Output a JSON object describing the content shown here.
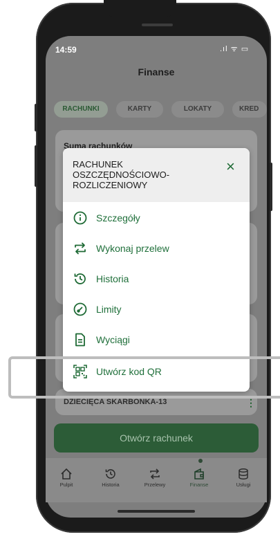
{
  "status": {
    "time": "14:59",
    "icons": ".ıl ᯤ ▭"
  },
  "header": {
    "title": "Finanse"
  },
  "tabs": [
    {
      "label": "RACHUNKI",
      "active": true
    },
    {
      "label": "KARTY",
      "active": false
    },
    {
      "label": "LOKATY",
      "active": false
    },
    {
      "label": "KRED",
      "active": false
    }
  ],
  "main": {
    "summary_label": "Suma rachunków",
    "account_name": "DZIECIĘCA SKARBONKA-13",
    "more_icon": "⋮",
    "open_account_label": "Otwórz rachunek"
  },
  "modal": {
    "title": "RACHUNEK OSZCZĘDNOŚCIOWO-ROZLICZENIOWY",
    "close_icon": "×",
    "items": [
      {
        "label": "Szczegóły",
        "icon": "info-icon"
      },
      {
        "label": "Wykonaj przelew",
        "icon": "transfer-icon"
      },
      {
        "label": "Historia",
        "icon": "history-icon"
      },
      {
        "label": "Limity",
        "icon": "gauge-icon"
      },
      {
        "label": "Wyciągi",
        "icon": "document-icon"
      },
      {
        "label": "Utwórz kod QR",
        "icon": "qr-code-icon"
      }
    ]
  },
  "bottom_nav": [
    {
      "label": "Pulpit",
      "icon": "home-icon"
    },
    {
      "label": "Historia",
      "icon": "history-icon"
    },
    {
      "label": "Przelewy",
      "icon": "transfer-icon"
    },
    {
      "label": "Finanse",
      "icon": "finance-icon",
      "active": true
    },
    {
      "label": "Usługi",
      "icon": "database-icon"
    }
  ],
  "colors": {
    "brand_green": "#1e6a35",
    "overlay": "#7e7e7e",
    "active_tab": "#2b5a34"
  }
}
